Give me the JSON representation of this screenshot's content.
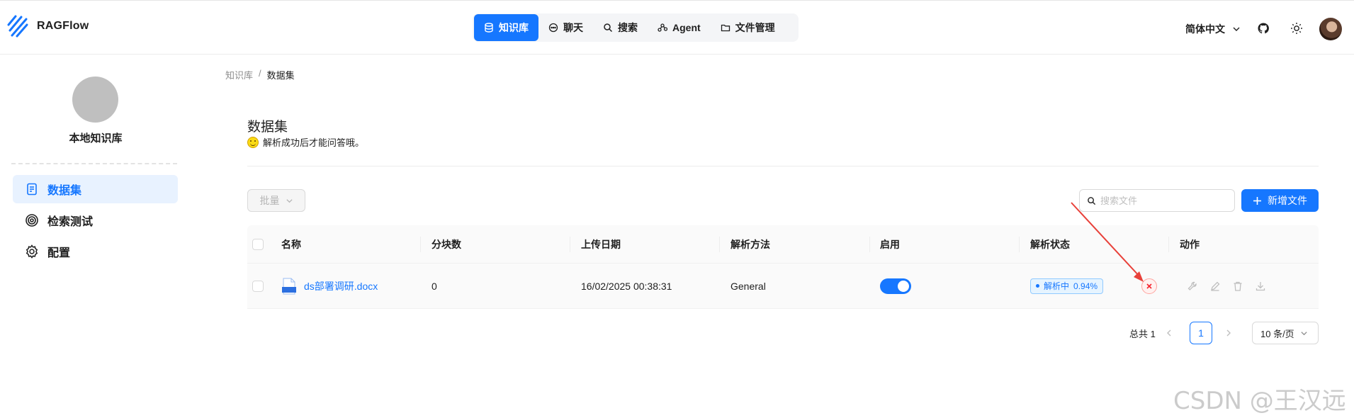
{
  "app": {
    "name": "RAGFlow"
  },
  "nav": {
    "items": [
      {
        "label": "知识库",
        "icon": "database-icon",
        "active": true
      },
      {
        "label": "聊天",
        "icon": "chat-bubble-icon",
        "active": false
      },
      {
        "label": "搜索",
        "icon": "search-icon",
        "active": false
      },
      {
        "label": "Agent",
        "icon": "graph-icon",
        "active": false
      },
      {
        "label": "文件管理",
        "icon": "folder-icon",
        "active": false
      }
    ]
  },
  "header": {
    "language": "简体中文",
    "github_icon": "github-icon",
    "theme_icon": "sun-icon",
    "avatar_icon": "user-avatar"
  },
  "sidebar": {
    "kb_name": "本地知识库",
    "items": [
      {
        "label": "数据集",
        "icon": "document-icon",
        "active": true
      },
      {
        "label": "检索测试",
        "icon": "target-icon",
        "active": false
      },
      {
        "label": "配置",
        "icon": "gear-icon",
        "active": false
      }
    ]
  },
  "breadcrumb": {
    "root": "知识库",
    "separator": "/",
    "current": "数据集"
  },
  "page": {
    "title": "数据集",
    "subtitle": "解析成功后才能问答哦。"
  },
  "toolbar": {
    "bulk_label": "批量",
    "search_placeholder": "搜索文件",
    "search_value": "",
    "add_label": "新增文件"
  },
  "table": {
    "columns": [
      "名称",
      "分块数",
      "上传日期",
      "解析方法",
      "启用",
      "解析状态",
      "动作"
    ],
    "rows": [
      {
        "name": "ds部署调研.docx",
        "file_type": "DOCX",
        "chunks": "0",
        "upload_date": "16/02/2025 00:38:31",
        "method": "General",
        "enabled": true,
        "status_label": "解析中",
        "status_progress": "0.94%",
        "cancel_icon": "close-icon",
        "actions": [
          "tool-icon",
          "edit-icon",
          "delete-icon",
          "download-icon"
        ]
      }
    ]
  },
  "pagination": {
    "total_label": "总共 1",
    "current_page": "1",
    "page_size": "10 条/页"
  },
  "watermark": "CSDN @王汉远",
  "colors": {
    "primary": "#1677ff",
    "danger": "#f5222d",
    "annotation_arrow": "#e8413a"
  }
}
